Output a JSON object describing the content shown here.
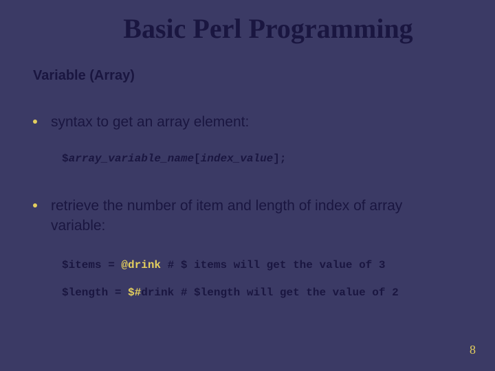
{
  "title": "Basic Perl Programming",
  "subtitle": "Variable (Array)",
  "bullets": [
    "syntax to get an array element:",
    "retrieve the number of item and length of index of array variable:"
  ],
  "code1": {
    "p1": "$",
    "p2": "array_variable_name",
    "p3": "[",
    "p4": "index_value",
    "p5": "];"
  },
  "code2": {
    "line1_a": "$items = ",
    "line1_b": "@drink",
    "line1_c": "   # $ items will get the value of 3",
    "line2_a": "$length = ",
    "line2_b": "$#",
    "line2_c": "drink",
    "line2_d": "   # $length will get the value of 2"
  },
  "page": "8"
}
